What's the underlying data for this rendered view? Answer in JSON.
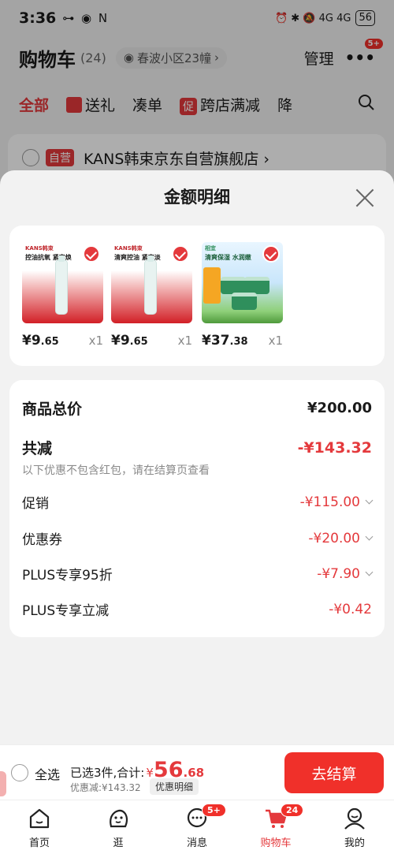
{
  "status_bar": {
    "time": "3:36",
    "left_icons": "⊶ ◉ N",
    "right_icons": "⏰ ✱ 🔕 4G 4G",
    "battery": "56"
  },
  "cart_header": {
    "title": "购物车",
    "count": "(24)",
    "address": "春波小区23幢",
    "manage": "管理",
    "more_badge": "5+"
  },
  "cart_tabs": {
    "all": "全部",
    "gift": "送礼",
    "bundle": "凑单",
    "promo_tag": "促",
    "cross_store": "跨店满减",
    "drop": "降"
  },
  "store": {
    "tag": "自营",
    "name": "KANS韩束京东自营旗舰店 ›"
  },
  "sheet": {
    "title": "金额明细",
    "products": [
      {
        "brand": "KANS韩束",
        "slogan": "控油抗氧 紧实焕",
        "price_int": "¥9",
        "price_dec": ".65",
        "qty": "x1"
      },
      {
        "brand": "KANS韩束",
        "slogan": "清爽控油 紧实淡",
        "price_int": "¥9",
        "price_dec": ".65",
        "qty": "x1"
      },
      {
        "brand": "相宜",
        "slogan": "清爽保湿 水润嫩",
        "price_int": "¥37",
        "price_dec": ".38",
        "qty": "x1"
      }
    ],
    "summary": {
      "total_label": "商品总价",
      "total_value": "¥200.00",
      "discount_label": "共减",
      "discount_value": "-¥143.32",
      "discount_note": "以下优惠不包含红包，请在结算页查看",
      "promo_label": "促销",
      "promo_value": "-¥115.00",
      "coupon_label": "优惠券",
      "coupon_value": "-¥20.00",
      "plus95_label": "PLUS专享95折",
      "plus95_value": "-¥7.90",
      "plus_off_label": "PLUS专享立减",
      "plus_off_value": "-¥0.42"
    }
  },
  "checkout": {
    "select_all": "全选",
    "selected_text": "已选3件,合计:",
    "currency": "¥",
    "total_int": "56",
    "total_dec": ".68",
    "savings": "优惠减:¥143.32",
    "detail_button": "优惠明细",
    "checkout_button": "去结算"
  },
  "navbar": {
    "items": [
      {
        "label": "首页",
        "icon": "home-icon"
      },
      {
        "label": "逛",
        "icon": "browse-icon"
      },
      {
        "label": "消息",
        "icon": "message-icon",
        "badge": "5+"
      },
      {
        "label": "购物车",
        "icon": "cart-icon",
        "badge": "24"
      },
      {
        "label": "我的",
        "icon": "profile-icon"
      }
    ]
  },
  "colors": {
    "accent": "#e4393c",
    "button": "#f0302a"
  }
}
